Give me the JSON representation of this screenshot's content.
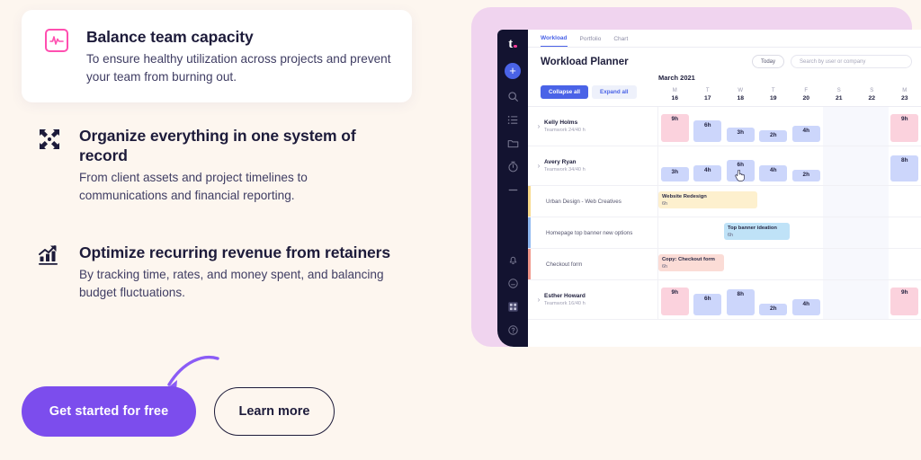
{
  "features": [
    {
      "icon": "pulse-monitor-icon",
      "title": "Balance team capacity",
      "body": "To ensure healthy utilization across projects and prevent your team from burning out."
    },
    {
      "icon": "collapse-arrows-icon",
      "title": "Organize everything in one system of record",
      "body": "From client assets and project timelines to communications and financial reporting."
    },
    {
      "icon": "bar-chart-trend-icon",
      "title": "Optimize recurring revenue from retainers",
      "body": "By tracking time, rates, and money spent, and balancing budget fluctuations."
    }
  ],
  "cta": {
    "primary_label": "Get started for free",
    "secondary_label": "Learn more"
  },
  "colors": {
    "page_bg": "#fdf6ef",
    "accent_purple": "#7c4ded",
    "accent_pink": "#ff4fb0",
    "navy": "#1d1b3a",
    "panel_pink": "#f0d4ef",
    "app_blue": "#4a63e7"
  },
  "app": {
    "logo": "t.",
    "sidebar_icons": [
      "plus-icon",
      "search-icon",
      "list-icon",
      "folder-icon",
      "timer-icon",
      "more-icon",
      "bell-icon",
      "clock-icon",
      "grid-icon",
      "help-icon"
    ],
    "tabs": [
      {
        "label": "Workload",
        "active": true
      },
      {
        "label": "Portfolio",
        "active": false
      },
      {
        "label": "Chart",
        "active": false
      }
    ],
    "title": "Workload Planner",
    "today_label": "Today",
    "search_placeholder": "Search by user or company",
    "month": "March 2021",
    "collapse_label": "Collapse all",
    "expand_label": "Expand all",
    "days": [
      {
        "dow": "M",
        "num": "16",
        "weekend": false
      },
      {
        "dow": "T",
        "num": "17",
        "weekend": false
      },
      {
        "dow": "W",
        "num": "18",
        "weekend": false
      },
      {
        "dow": "T",
        "num": "19",
        "weekend": false
      },
      {
        "dow": "F",
        "num": "20",
        "weekend": false
      },
      {
        "dow": "S",
        "num": "21",
        "weekend": true
      },
      {
        "dow": "S",
        "num": "22",
        "weekend": true
      },
      {
        "dow": "M",
        "num": "23",
        "weekend": false
      }
    ],
    "rows": [
      {
        "type": "user",
        "name": "Kelly Holms",
        "meta": "Teamwork  24/40 h",
        "cells": [
          {
            "label": "9h",
            "hours": 9,
            "tone": "pink"
          },
          {
            "label": "6h",
            "hours": 6,
            "tone": "blue"
          },
          {
            "label": "3h",
            "hours": 3,
            "tone": "blue"
          },
          {
            "label": "2h",
            "hours": 2,
            "tone": "blue"
          },
          {
            "label": "4h",
            "hours": 4,
            "tone": "blue"
          },
          {
            "label": "",
            "hours": 0,
            "tone": "empty"
          },
          {
            "label": "",
            "hours": 0,
            "tone": "empty"
          },
          {
            "label": "9h",
            "hours": 9,
            "tone": "pink"
          }
        ]
      },
      {
        "type": "user",
        "name": "Avery Ryan",
        "meta": "Teamwork  34/40 h",
        "cells": [
          {
            "label": "3h",
            "hours": 3,
            "tone": "blue"
          },
          {
            "label": "4h",
            "hours": 4,
            "tone": "blue"
          },
          {
            "label": "6h",
            "hours": 6,
            "tone": "blue"
          },
          {
            "label": "4h",
            "hours": 4,
            "tone": "blue"
          },
          {
            "label": "2h",
            "hours": 2,
            "tone": "blue"
          },
          {
            "label": "",
            "hours": 0,
            "tone": "empty"
          },
          {
            "label": "",
            "hours": 0,
            "tone": "empty"
          },
          {
            "label": "8h",
            "hours": 8,
            "tone": "blue"
          }
        ]
      },
      {
        "type": "task",
        "name": "Urban Design - Web Creatives",
        "stripe": "#f7d98a",
        "bar": {
          "title": "Website Redesign",
          "hours": "6h",
          "tone": "sb-yellow",
          "start": 0,
          "span": 3
        }
      },
      {
        "type": "task",
        "name": "Homepage top banner new options",
        "stripe": "#8fb8f0",
        "bar": {
          "title": "Top banner ideation",
          "hours": "6h",
          "tone": "sb-blue",
          "start": 2,
          "span": 2
        }
      },
      {
        "type": "task",
        "name": "Checkout form",
        "stripe": "#f0968a",
        "bar": {
          "title": "Copy: Checkout form",
          "hours": "6h",
          "tone": "sb-red",
          "start": 0,
          "span": 2
        }
      },
      {
        "type": "user",
        "name": "Esther Howard",
        "meta": "Teamwork  16/40 h",
        "cells": [
          {
            "label": "9h",
            "hours": 9,
            "tone": "pink"
          },
          {
            "label": "6h",
            "hours": 6,
            "tone": "blue"
          },
          {
            "label": "8h",
            "hours": 8,
            "tone": "blue"
          },
          {
            "label": "2h",
            "hours": 2,
            "tone": "blue"
          },
          {
            "label": "4h",
            "hours": 4,
            "tone": "blue"
          },
          {
            "label": "",
            "hours": 0,
            "tone": "empty"
          },
          {
            "label": "",
            "hours": 0,
            "tone": "empty"
          },
          {
            "label": "9h",
            "hours": 9,
            "tone": "pink"
          }
        ]
      }
    ]
  }
}
